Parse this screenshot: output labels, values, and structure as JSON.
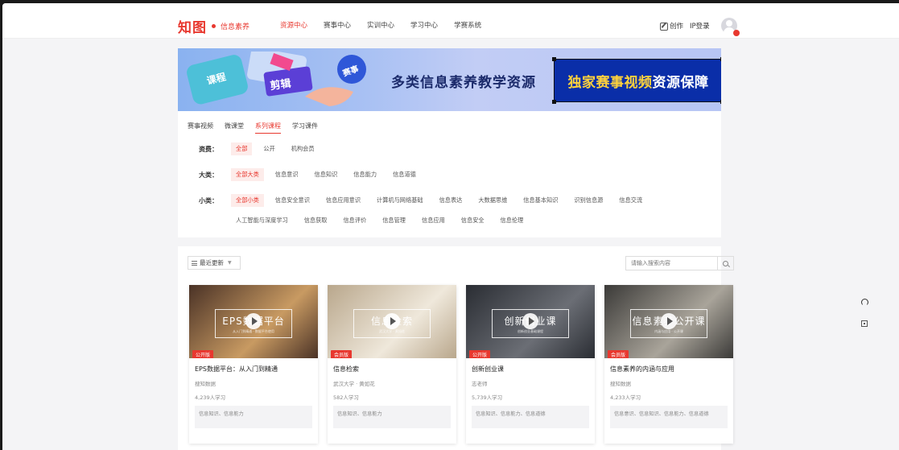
{
  "nav": {
    "logo": "知图",
    "logo_sub": "信息素养",
    "links": [
      "资源中心",
      "赛事中心",
      "实训中心",
      "学习中心",
      "学赛系统"
    ],
    "active_index": 0,
    "create_label": "创作",
    "login_label": "IP登录"
  },
  "banner": {
    "main_text": "多类信息素养教学资源",
    "box_text_highlight": "独家赛事视频",
    "box_text_rest": "资源保障",
    "art_words": [
      "课程",
      "剪辑",
      "赛事"
    ]
  },
  "tabs": [
    "赛事视频",
    "微课堂",
    "系列课程",
    "学习课件"
  ],
  "active_tab": 2,
  "filters": [
    {
      "label": "资费：",
      "options": [
        "全部",
        "公开",
        "机构会员"
      ],
      "selected": 0
    },
    {
      "label": "大类：",
      "options": [
        "全部大类",
        "信息意识",
        "信息知识",
        "信息能力",
        "信息道德"
      ],
      "selected": 0
    },
    {
      "label": "小类：",
      "options": [
        "全部小类",
        "信息安全意识",
        "信息应用意识",
        "计算机与网络基础",
        "信息表达",
        "大数据思维",
        "信息基本知识",
        "识别信息源",
        "信息交流",
        "人工智能与深度学习",
        "信息获取",
        "信息评价",
        "信息管理",
        "信息应用",
        "信息安全",
        "信息伦理"
      ],
      "selected": 0
    }
  ],
  "sort_label": "最近更新",
  "search_placeholder": "请输入搜索内容",
  "cards": [
    {
      "thumb_title": "EPS数据平台",
      "thumb_sub": "从入门到精通 · 数据平台使用",
      "tag": "公开版",
      "title": "EPS数据平台：从入门到精通",
      "author": "搜知数据",
      "count": "4,239人学习",
      "tags": "信息知识、信息能力",
      "bg": "#4a3226",
      "bg2": "#c89a62"
    },
    {
      "thumb_title": "信息检索",
      "thumb_sub": "武汉大学 · 黄如花",
      "tag": "会员版",
      "title": "信息检索",
      "author": "武汉大学 · 黄如花",
      "count": "582人学习",
      "tags": "信息知识、信息能力",
      "bg": "#b9a78c",
      "bg2": "#efe8db"
    },
    {
      "thumb_title": "创新创业课",
      "thumb_sub": "创新创业基础课程",
      "tag": "公开版",
      "title": "创新创业课",
      "author": "志老师",
      "count": "5,739人学习",
      "tags": "信息知识、信息能力、信息道德",
      "bg": "#2a2d33",
      "bg2": "#6b6e75"
    },
    {
      "thumb_title": "信息素养公开课",
      "thumb_sub": "内涵与应用 · 公开课",
      "tag": "会员版",
      "title": "信息素养的内涵与应用",
      "author": "搜知数据",
      "count": "4,233人学习",
      "tags": "信息意识、信息知识、信息能力、信息道德",
      "bg": "#3b3a38",
      "bg2": "#a9a49a"
    }
  ]
}
